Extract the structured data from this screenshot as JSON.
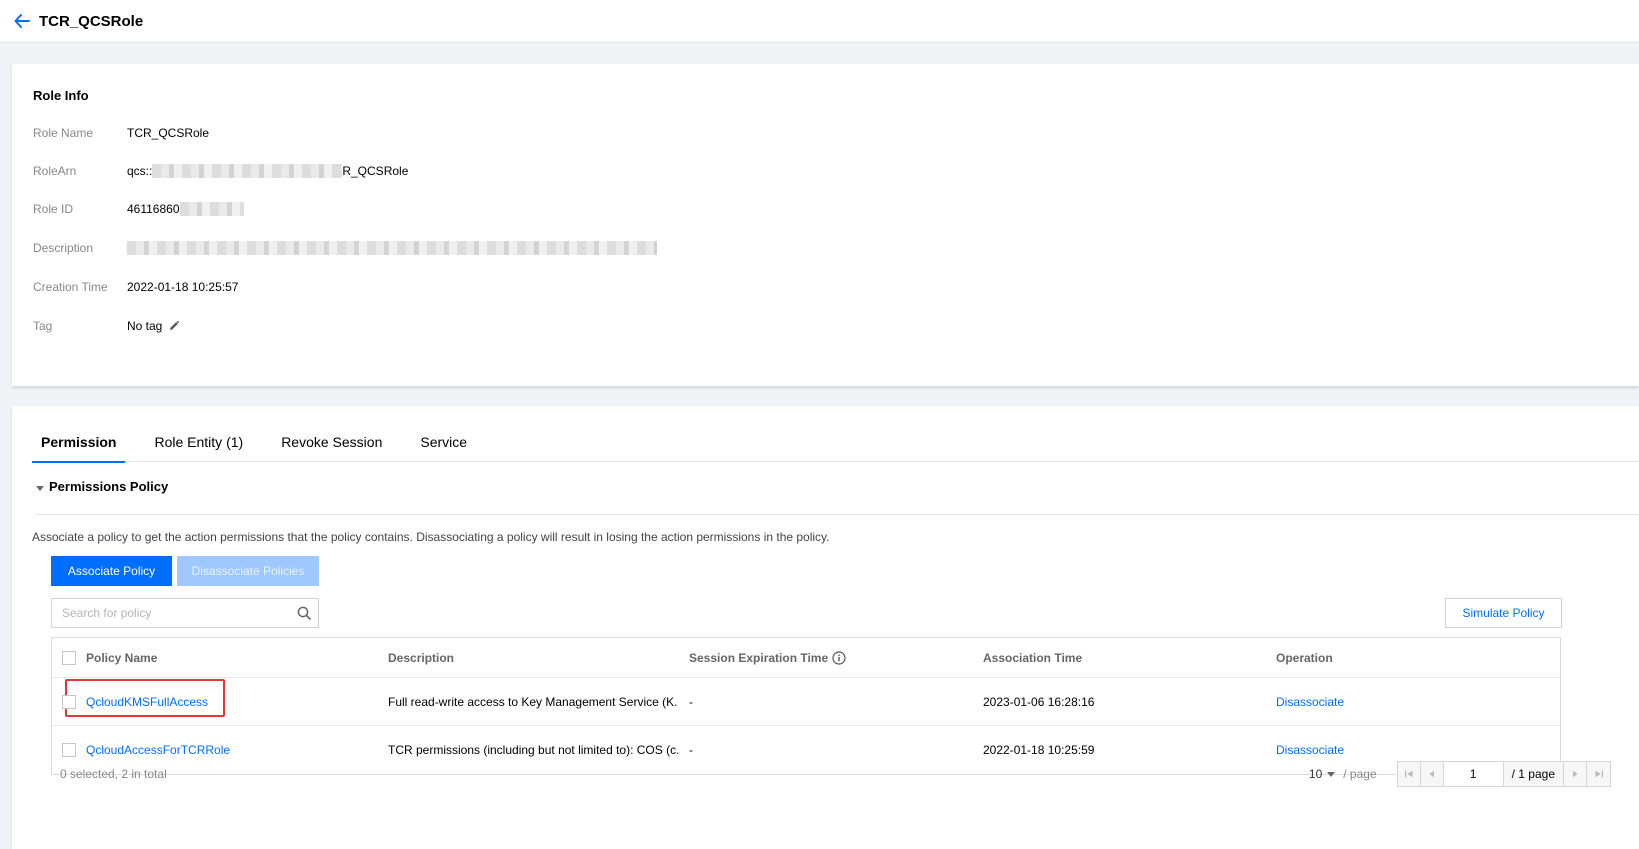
{
  "header": {
    "title": "TCR_QCSRole"
  },
  "role_info": {
    "title": "Role Info",
    "rows": [
      {
        "label": "Role Name",
        "value": "TCR_QCSRole"
      },
      {
        "label": "RoleArn",
        "value_prefix": "qcs::",
        "value_suffix": "R_QCSRole"
      },
      {
        "label": "Role ID",
        "value": "46116860"
      },
      {
        "label": "Description",
        "value": ""
      },
      {
        "label": "Creation Time",
        "value": "2022-01-18 10:25:57"
      },
      {
        "label": "Tag",
        "value": "No tag"
      }
    ]
  },
  "tabs": [
    {
      "label": "Permission",
      "active": true
    },
    {
      "label": "Role Entity (1)"
    },
    {
      "label": "Revoke Session"
    },
    {
      "label": "Service"
    }
  ],
  "permissions": {
    "section_title": "Permissions Policy",
    "description": "Associate a policy to get the action permissions that the policy contains. Disassociating a policy will result in losing the action permissions in the policy.",
    "associate_label": "Associate Policy",
    "disassociate_label": "Disassociate Policies",
    "search_placeholder": "Search for policy",
    "simulate_label": "Simulate Policy",
    "columns": [
      "Policy Name",
      "Description",
      "Session Expiration Time",
      "Association Time",
      "Operation"
    ],
    "rows": [
      {
        "name": "QcloudKMSFullAccess",
        "description": "Full read-write access to Key Management Service (K...",
        "session": "-",
        "time": "2023-01-06 16:28:16",
        "operation": "Disassociate"
      },
      {
        "name": "QcloudAccessForTCRRole",
        "description": "TCR permissions (including but not limited to): COS (c...",
        "session": "-",
        "time": "2022-01-18 10:25:59",
        "operation": "Disassociate"
      }
    ],
    "footer": "0 selected, 2 in total",
    "pager": {
      "page_size": "10",
      "per_page": "/ page",
      "current": "1",
      "total": "/ 1 page"
    }
  },
  "colors": {
    "accent": "#006eff",
    "highlight": "#e53535"
  }
}
